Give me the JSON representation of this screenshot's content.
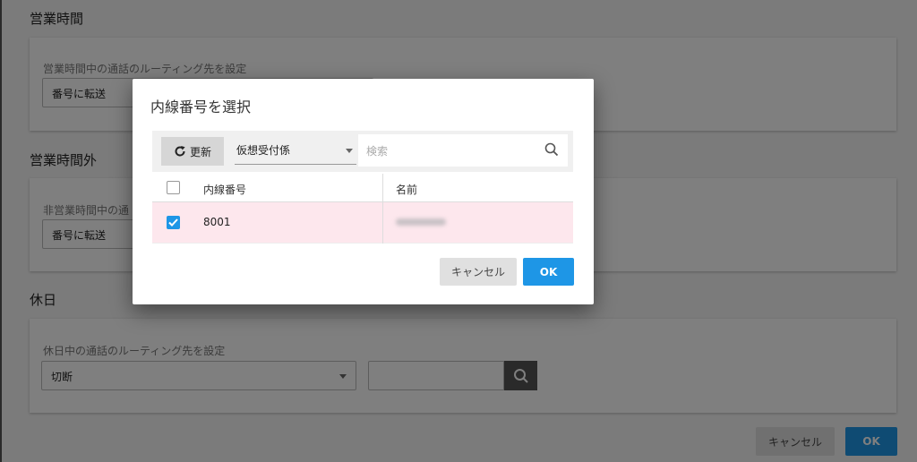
{
  "page": {
    "sections": [
      {
        "title": "営業時間",
        "label": "営業時間中の通話のルーティング先を設定",
        "select_value": "番号に転送"
      },
      {
        "title": "営業時間外",
        "label": "非営業時間中の通",
        "select_value": "番号に転送"
      },
      {
        "title": "休日",
        "label": "休日中の通話のルーティング先を設定",
        "select_value": "切断"
      }
    ],
    "cancel_label": "キャンセル",
    "ok_label": "OK"
  },
  "dialog": {
    "title": "内線番号を選択",
    "refresh_label": "更新",
    "group_select": "仮想受付係",
    "search_placeholder": "検索",
    "columns": [
      "内線番号",
      "名前"
    ],
    "rows": [
      {
        "extension": "8001",
        "selected": true
      }
    ],
    "cancel_label": "キャンセル",
    "ok_label": "OK"
  },
  "colors": {
    "accent": "#1e96e6",
    "selected_row": "#fde7ed"
  }
}
